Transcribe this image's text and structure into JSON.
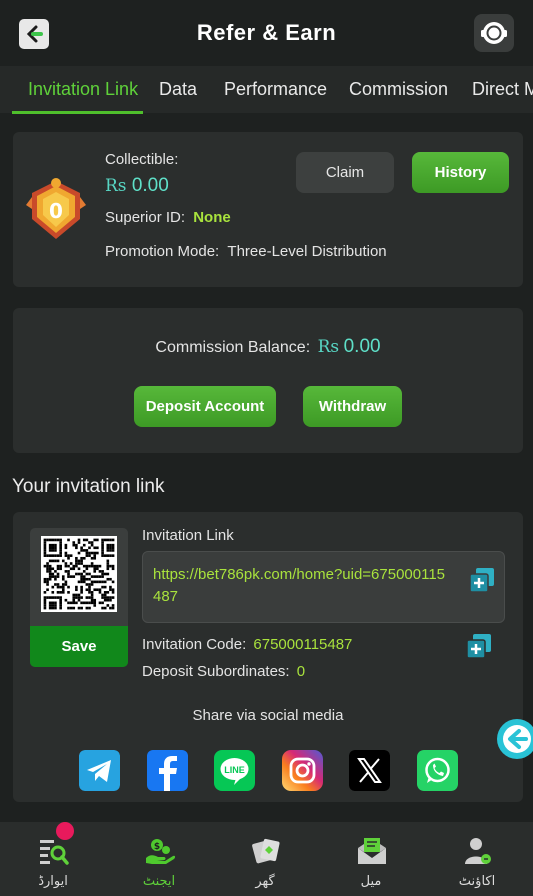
{
  "header": {
    "title": "Refer & Earn",
    "back_icon": "arrow-left-icon",
    "support_icon": "headset-icon"
  },
  "tabs": [
    {
      "label": "Invitation Link",
      "active": true
    },
    {
      "label": "Data",
      "active": false
    },
    {
      "label": "Performance",
      "active": false
    },
    {
      "label": "Commission",
      "active": false
    },
    {
      "label": "Direct M",
      "active": false
    }
  ],
  "summary": {
    "medal_level": "0",
    "collectible_label": "Collectible:",
    "currency": "Rs",
    "collectible_value": "0.00",
    "superior_label": "Superior ID:",
    "superior_value": "None",
    "promotion_label": "Promotion Mode:",
    "promotion_value": "Three-Level Distribution",
    "claim_label": "Claim",
    "history_label": "History"
  },
  "balance": {
    "label": "Commission Balance:",
    "currency": "Rs",
    "value": "0.00",
    "deposit_label": "Deposit Account",
    "withdraw_label": "Withdraw"
  },
  "invite": {
    "section_title": "Your invitation link",
    "save_label": "Save",
    "link_label": "Invitation Link",
    "link_value": "https://bet786pk.com/home?uid=675000115487",
    "code_label": "Invitation Code:",
    "code_value": "675000115487",
    "subordinates_label": "Deposit Subordinates:",
    "subordinates_value": "0",
    "share_label": "Share via social media",
    "social": [
      "telegram",
      "facebook",
      "line",
      "instagram",
      "x",
      "whatsapp"
    ]
  },
  "bottom_nav": [
    {
      "label": "ایوارڈ",
      "icon": "search-list-icon",
      "active": false,
      "badge": true
    },
    {
      "label": "ایجنٹ",
      "icon": "agent-money-icon",
      "active": true,
      "badge": false
    },
    {
      "label": "گھر",
      "icon": "home-cards-icon",
      "active": false,
      "badge": false
    },
    {
      "label": "میل",
      "icon": "mail-icon",
      "active": false,
      "badge": false
    },
    {
      "label": "اکاؤنٹ",
      "icon": "account-icon",
      "active": false,
      "badge": false
    }
  ],
  "colors": {
    "accent": "#5fd13a",
    "money": "#5fe0c8",
    "link": "#a9e33d",
    "background": "#1e2120",
    "card": "#2b2e2d"
  }
}
